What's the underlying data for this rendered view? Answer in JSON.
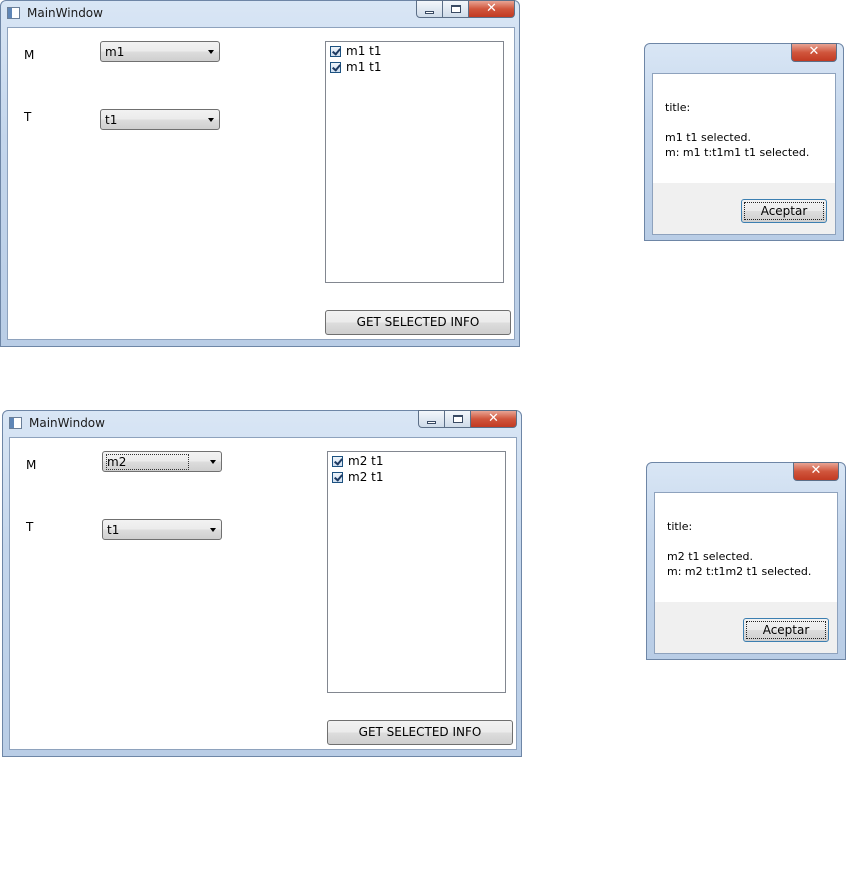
{
  "windows": [
    {
      "title": "MainWindow",
      "labels": {
        "m": "M",
        "t": "T"
      },
      "combo_m": {
        "value": "m1",
        "focused": false
      },
      "combo_t": {
        "value": "t1"
      },
      "list_items": [
        {
          "text": "m1 t1",
          "checked": true
        },
        {
          "text": "m1 t1",
          "checked": true
        }
      ],
      "button": "GET SELECTED INFO",
      "close_glyph": "✕"
    },
    {
      "title": "MainWindow",
      "labels": {
        "m": "M",
        "t": "T"
      },
      "combo_m": {
        "value": "m2",
        "focused": true
      },
      "combo_t": {
        "value": "t1"
      },
      "list_items": [
        {
          "text": "m2 t1",
          "checked": true
        },
        {
          "text": "m2 t1",
          "checked": true
        }
      ],
      "button": "GET SELECTED INFO",
      "close_glyph": "✕"
    }
  ],
  "dialogs": [
    {
      "line1": "title:",
      "line2": "m1 t1 selected.",
      "line3": "m: m1 t:t1m1 t1 selected.",
      "ok": "Aceptar",
      "close_glyph": "✕"
    },
    {
      "line1": "title:",
      "line2": "m2 t1 selected.",
      "line3": "m: m2 t:t1m2 t1 selected.",
      "ok": "Aceptar",
      "close_glyph": "✕"
    }
  ],
  "icons": {
    "app": "app-icon",
    "minimize": "minimize-icon",
    "maximize": "maximize-icon",
    "close": "close-icon",
    "dropdown": "chevron-down-icon",
    "checkbox": "checkmark-icon"
  }
}
